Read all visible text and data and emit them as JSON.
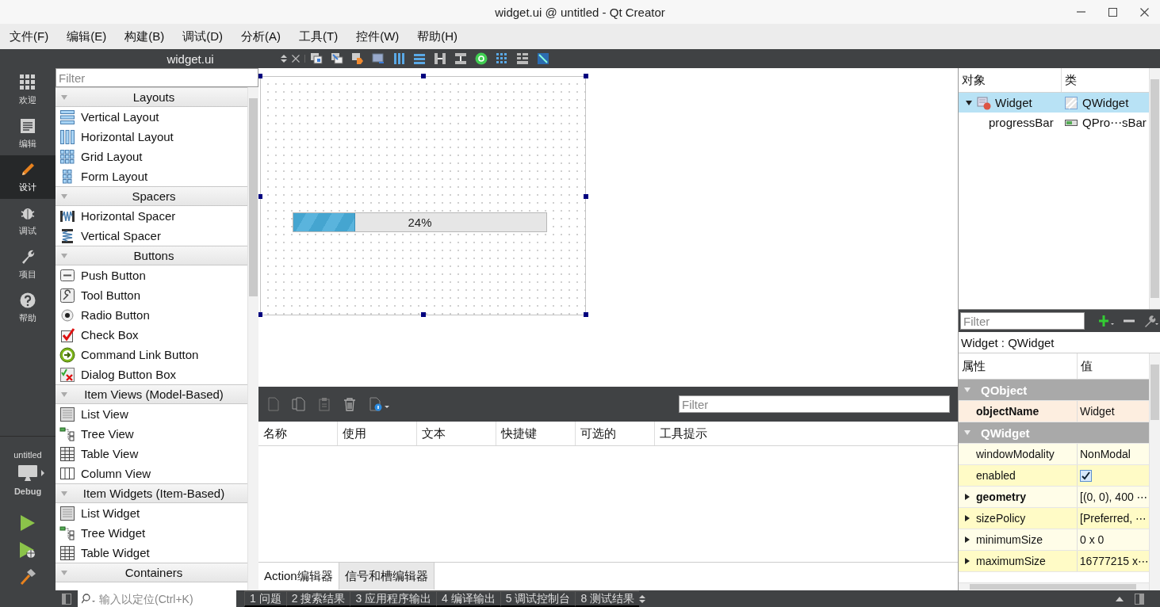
{
  "window": {
    "title": "widget.ui @ untitled - Qt Creator"
  },
  "menu": [
    "文件(F)",
    "编辑(E)",
    "构建(B)",
    "调试(D)",
    "分析(A)",
    "工具(T)",
    "控件(W)",
    "帮助(H)"
  ],
  "modes": [
    {
      "label": "欢迎",
      "selected": false
    },
    {
      "label": "编辑",
      "selected": false
    },
    {
      "label": "设计",
      "selected": true
    },
    {
      "label": "调试",
      "selected": false
    },
    {
      "label": "项目",
      "selected": false
    },
    {
      "label": "帮助",
      "selected": false
    }
  ],
  "target": {
    "project": "untitled",
    "build": "Debug"
  },
  "editor_toolbar": {
    "file": "widget.ui"
  },
  "widget_box": {
    "filter": {
      "placeholder": "Filter"
    },
    "categories": [
      {
        "title": "Layouts",
        "items": [
          "Vertical Layout",
          "Horizontal Layout",
          "Grid Layout",
          "Form Layout"
        ]
      },
      {
        "title": "Spacers",
        "items": [
          "Horizontal Spacer",
          "Vertical Spacer"
        ]
      },
      {
        "title": "Buttons",
        "items": [
          "Push Button",
          "Tool Button",
          "Radio Button",
          "Check Box",
          "Command Link Button",
          "Dialog Button Box"
        ]
      },
      {
        "title": "Item Views (Model-Based)",
        "items": [
          "List View",
          "Tree View",
          "Table View",
          "Column View"
        ]
      },
      {
        "title": "Item Widgets (Item-Based)",
        "items": [
          "List Widget",
          "Tree Widget",
          "Table Widget"
        ]
      },
      {
        "title": "Containers"
      }
    ]
  },
  "form": {
    "progress_bar": {
      "level": 0.24,
      "text": "24%"
    }
  },
  "action_editor": {
    "filter": {
      "placeholder": "Filter"
    },
    "columns": [
      "名称",
      "使用",
      "文本",
      "快捷键",
      "可选的",
      "工具提示"
    ],
    "tabs": [
      {
        "label": "Action编辑器",
        "selected": true
      },
      {
        "label": "信号和槽编辑器",
        "selected": false
      }
    ]
  },
  "object_inspector": {
    "columns": [
      "对象",
      "类"
    ],
    "tree": [
      {
        "name": "Widget",
        "class": "QWidget",
        "selected": true,
        "expanded": true,
        "children": [
          {
            "name": "progressBar",
            "class": "QPro⋯sBar",
            "selected": false
          }
        ]
      }
    ]
  },
  "property_editor": {
    "filter": {
      "placeholder": "Filter"
    },
    "object_label": "Widget : QWidget",
    "columns": [
      "属性",
      "值"
    ],
    "rows": [
      {
        "kind": "group",
        "label": "QObject",
        "expanded": true
      },
      {
        "kind": "property",
        "name": "objectName",
        "value": "Widget",
        "changed": true,
        "expandable": false
      },
      {
        "kind": "group",
        "label": "QWidget",
        "expanded": true
      },
      {
        "kind": "property",
        "name": "windowModality",
        "value": "NonModal",
        "changed": false,
        "expandable": false
      },
      {
        "kind": "checkbox",
        "name": "enabled",
        "checked": true,
        "changed": false,
        "expandable": false
      },
      {
        "kind": "property",
        "name": "geometry",
        "value": "[(0, 0), 400 ⋯",
        "changed": true,
        "expandable": true
      },
      {
        "kind": "property",
        "name": "sizePolicy",
        "value": "[Preferred, ⋯",
        "changed": false,
        "expandable": true
      },
      {
        "kind": "property",
        "name": "minimumSize",
        "value": "0 x 0",
        "changed": false,
        "expandable": true
      },
      {
        "kind": "property",
        "name": "maximumSize",
        "value": "16777215 x⋯",
        "changed": false,
        "expandable": true
      }
    ]
  },
  "status_bar": {
    "locator": {
      "placeholder": "输入以定位(Ctrl+K)"
    },
    "panes": [
      "1 问题",
      "2 搜索结果",
      "3 应用程序输出",
      "4 编译输出",
      "5 调试控制台",
      "8 测试结果"
    ]
  }
}
